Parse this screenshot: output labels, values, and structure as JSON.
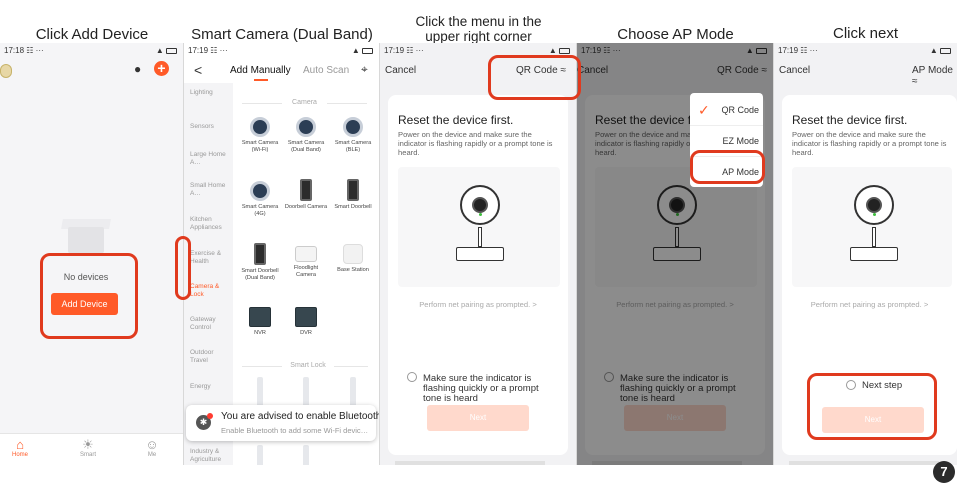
{
  "captions": {
    "step1": "Click Add Device",
    "step2": "Smart Camera  (Dual Band)",
    "step3_line1": "Click the menu in the",
    "step3_line2": "upper right corner",
    "step4": "Choose AP Mode",
    "step5": "Click next"
  },
  "status": {
    "time1": "17:18",
    "time2": "17:19",
    "extras": "☷ ···",
    "icons": "▲"
  },
  "home": {
    "empty_text": "No devices",
    "add_button": "Add Device",
    "tabs": [
      {
        "label": "Home",
        "icon": "⌂"
      },
      {
        "label": "Smart",
        "icon": "☀"
      },
      {
        "label": "Me",
        "icon": "☺"
      }
    ],
    "colors": {
      "accent": "#ff5a28"
    }
  },
  "add_manually": {
    "back": "<",
    "tab_manual": "Add Manually",
    "tab_scan": "Auto Scan",
    "scan_icon": "⌖",
    "sidebar": [
      "Lighting",
      "Sensors",
      "Large Home A…",
      "Small Home A…",
      "Kitchen Appliances",
      "Exercise & Health",
      "Camera & Lock",
      "Gateway Control",
      "Outdoor Travel",
      "Energy",
      "Industry & Agriculture"
    ],
    "section_camera": "Camera",
    "section_lock": "Smart Lock",
    "devices": [
      "Smart Camera (Wi-Fi)",
      "Smart Camera (Dual Band)",
      "Smart Camera (BLE)",
      "Smart Camera (4G)",
      "Doorbell Camera",
      "Smart Doorbell",
      "Smart Doorbell (Dual Band)",
      "Floodlight Camera",
      "Base Station",
      "NVR",
      "DVR"
    ],
    "toast_title": "You are advised to enable Bluetooth.",
    "toast_sub": "Enable Bluetooth to add some Wi-Fi devic…",
    "toast_icon": "✱"
  },
  "wizard": {
    "cancel": "Cancel",
    "mode_qr": "QR Code ≈",
    "mode_ap": "AP Mode ≈",
    "title": "Reset the device first.",
    "desc": "Power on the device and make sure the indicator is flashing rapidly or a prompt tone is heard.",
    "perform": "Perform net pairing as prompted. >",
    "confirm": "Make sure the indicator is flashing quickly or a prompt tone is heard",
    "next": "Next",
    "next_step": "Next step"
  },
  "mode_menu": {
    "items": [
      "QR Code",
      "EZ Mode",
      "AP Mode"
    ],
    "check": "✓"
  },
  "page_number": "7"
}
